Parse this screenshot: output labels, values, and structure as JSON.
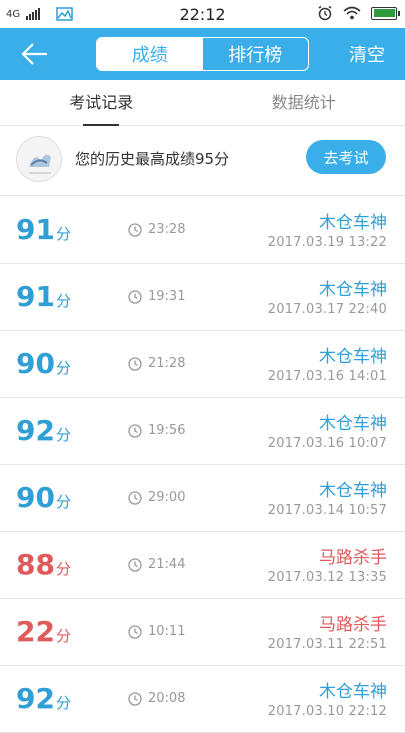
{
  "status_bar": {
    "network": "4G",
    "time": "22:12"
  },
  "nav": {
    "tabs": [
      "成绩",
      "排行榜"
    ],
    "active_tab": 0,
    "clear_label": "清空"
  },
  "subtabs": [
    "考试记录",
    "数据统计"
  ],
  "best": {
    "text": "您的历史最高成绩95分",
    "button_label": "去考试"
  },
  "colors": {
    "accent": "#3aaee9",
    "pass": "#2f9fd6",
    "fail": "#df5a5a"
  },
  "records": [
    {
      "score": "91",
      "unit": "分",
      "duration": "23:28",
      "name": "木仓车神",
      "date": "2017.03.19  13:22",
      "status": "blue"
    },
    {
      "score": "91",
      "unit": "分",
      "duration": "19:31",
      "name": "木仓车神",
      "date": "2017.03.17  22:40",
      "status": "blue"
    },
    {
      "score": "90",
      "unit": "分",
      "duration": "21:28",
      "name": "木仓车神",
      "date": "2017.03.16  14:01",
      "status": "blue"
    },
    {
      "score": "92",
      "unit": "分",
      "duration": "19:56",
      "name": "木仓车神",
      "date": "2017.03.16  10:07",
      "status": "blue"
    },
    {
      "score": "90",
      "unit": "分",
      "duration": "29:00",
      "name": "木仓车神",
      "date": "2017.03.14  10:57",
      "status": "blue"
    },
    {
      "score": "88",
      "unit": "分",
      "duration": "21:44",
      "name": "马路杀手",
      "date": "2017.03.12  13:35",
      "status": "red"
    },
    {
      "score": "22",
      "unit": "分",
      "duration": "10:11",
      "name": "马路杀手",
      "date": "2017.03.11  22:51",
      "status": "red"
    },
    {
      "score": "92",
      "unit": "分",
      "duration": "20:08",
      "name": "木仓车神",
      "date": "2017.03.10  22:12",
      "status": "blue"
    }
  ]
}
